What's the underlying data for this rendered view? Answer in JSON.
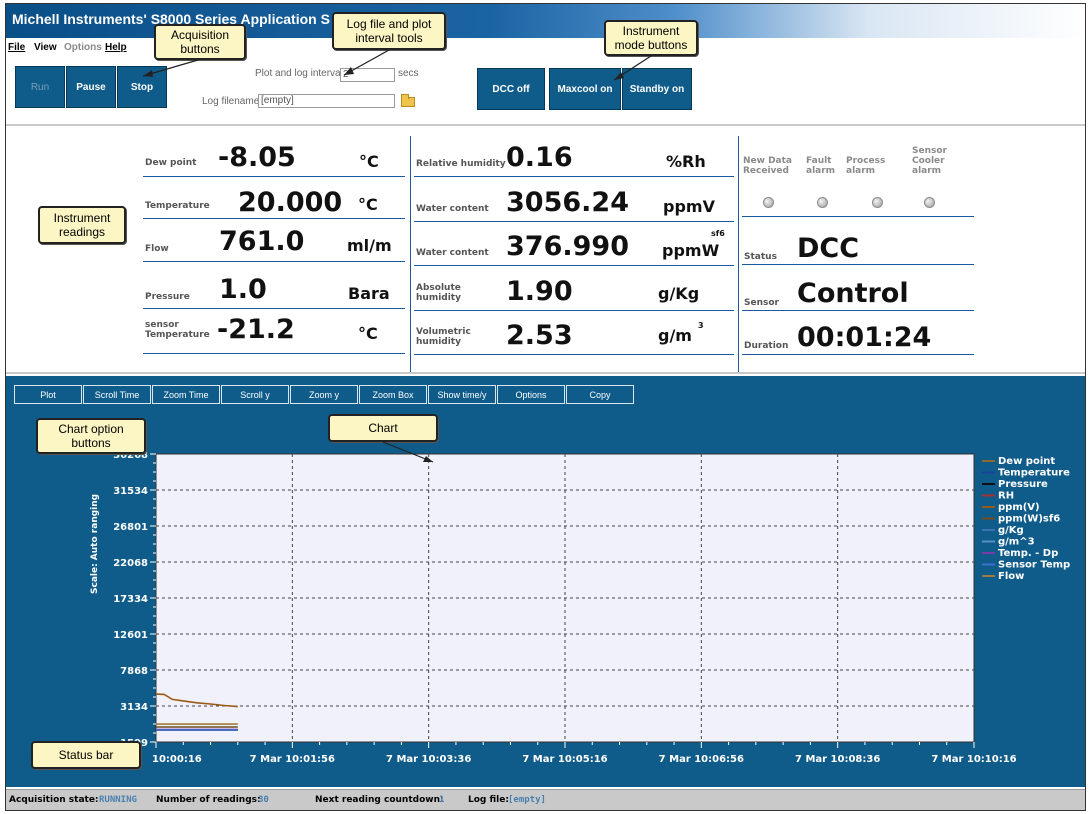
{
  "window": {
    "title": "Michell Instruments' S8000 Series Application S"
  },
  "menu": {
    "file": "File",
    "view": "View",
    "options": "Options",
    "help": "Help"
  },
  "acquisition": {
    "run": "Run",
    "pause": "Pause",
    "stop": "Stop"
  },
  "log_tools": {
    "interval_label": "Plot and log interval",
    "interval_value": "2",
    "interval_unit": "secs",
    "filename_label": "Log filename",
    "filename_value": "[empty]"
  },
  "mode_buttons": {
    "dcc_off": "DCC off",
    "maxcool_on": "Maxcool on",
    "standby_on": "Standby on"
  },
  "readings_left": [
    {
      "label": "Dew point",
      "value": "-8.05",
      "unit": "°C"
    },
    {
      "label": "Temperature",
      "value": "20.000",
      "unit": "°C"
    },
    {
      "label": "Flow",
      "value": "761.0",
      "unit": "ml/m"
    },
    {
      "label": "Pressure",
      "value": "1.0",
      "unit": "Bara"
    },
    {
      "label": "sensor Temperature",
      "value": "-21.2",
      "unit": "°C"
    }
  ],
  "readings_mid": [
    {
      "label": "Relative humidity",
      "value": "0.16",
      "unit": "%Rh",
      "sup": ""
    },
    {
      "label": "Water content",
      "value": "3056.24",
      "unit": "ppmV",
      "sup": ""
    },
    {
      "label": "Water content",
      "value": "376.990",
      "unit": "ppmW",
      "sup": "sf6"
    },
    {
      "label": "Absolute humidity",
      "value": "1.90",
      "unit": "g/Kg",
      "sup": ""
    },
    {
      "label": "Volumetric humidity",
      "value": "2.53",
      "unit": "g/m",
      "sup": "3"
    }
  ],
  "alarms": [
    {
      "label": "New Data Received"
    },
    {
      "label": "Fault alarm"
    },
    {
      "label": "Process alarm"
    },
    {
      "label": "Sensor Cooler alarm"
    }
  ],
  "status_panel": [
    {
      "label": "Status",
      "value": "DCC"
    },
    {
      "label": "Sensor",
      "value": "Control"
    },
    {
      "label": "Duration",
      "value": "00:01:24"
    }
  ],
  "chart_buttons": [
    "Plot",
    "Scroll Time",
    "Zoom Time",
    "Scroll y",
    "Zoom y",
    "Zoom Box",
    "Show time/y",
    "Options",
    "Copy"
  ],
  "chart_data": {
    "type": "line",
    "ylabel": "Scale: Auto ranging",
    "ylim": [
      -1599,
      36268
    ],
    "y_ticks": [
      -1599,
      3134,
      7868,
      12601,
      17334,
      22068,
      26801,
      31534,
      36268
    ],
    "y_tick_labels": [
      "-1599",
      "3134",
      "7868",
      "12601",
      "17334",
      "22068",
      "26801",
      "31534",
      "36268"
    ],
    "x_tick_labels": [
      "10:00:16",
      "7 Mar 10:01:56",
      "7 Mar 10:03:36",
      "7 Mar 10:05:16",
      "7 Mar 10:06:56",
      "7 Mar 10:08:36",
      "7 Mar 10:10:16"
    ],
    "x_range_seconds": [
      0,
      600
    ],
    "grid": true,
    "legend_position": "right",
    "plot_background": "#f1f1fb",
    "series": [
      {
        "name": "Dew point",
        "color": "#8b6a2a",
        "x": [
          0,
          60
        ],
        "y": [
          -8,
          -8
        ]
      },
      {
        "name": "Temperature",
        "color": "#1e3f9e",
        "x": [
          0,
          60
        ],
        "y": [
          20,
          20
        ]
      },
      {
        "name": "Pressure",
        "color": "#111111",
        "x": [
          0,
          60
        ],
        "y": [
          1,
          1
        ]
      },
      {
        "name": "RH",
        "color": "#aa2f2f",
        "x": [
          0,
          60
        ],
        "y": [
          0.2,
          0.2
        ]
      },
      {
        "name": "ppm(V)",
        "color": "#9b5a14",
        "x": [
          0,
          6,
          12,
          20,
          30,
          40,
          50,
          60
        ],
        "y": [
          4700,
          4660,
          4000,
          3800,
          3560,
          3400,
          3200,
          3060
        ]
      },
      {
        "name": "ppm(W)sf6",
        "color": "#6e4c20",
        "x": [
          0,
          60
        ],
        "y": [
          377,
          377
        ]
      },
      {
        "name": "g/Kg",
        "color": "#3a74b5",
        "x": [
          0,
          60
        ],
        "y": [
          1.9,
          1.9
        ]
      },
      {
        "name": "g/m^3",
        "color": "#5a8fc8",
        "x": [
          0,
          60
        ],
        "y": [
          2.5,
          2.5
        ]
      },
      {
        "name": "Temp. - Dp",
        "color": "#7a3aa8",
        "x": [
          0,
          60
        ],
        "y": [
          28,
          28
        ]
      },
      {
        "name": "Sensor Temp",
        "color": "#3b6fd0",
        "x": [
          0,
          60
        ],
        "y": [
          -21,
          -21
        ]
      },
      {
        "name": "Flow",
        "color": "#a07a3a",
        "x": [
          0,
          60
        ],
        "y": [
          761,
          761
        ]
      }
    ]
  },
  "statusbar": {
    "state_label": "Acquisition state:",
    "state_value": "RUNNING",
    "readings_label": "Number of readings:",
    "readings_value": "30",
    "countdown_label": "Next reading countdown:",
    "countdown_value": "1",
    "logfile_label": "Log file:",
    "logfile_value": "[empty]"
  },
  "callouts": {
    "acquisition": "Acquisition buttons",
    "logtools": "Log file and plot interval tools",
    "mode": "Instrument mode buttons",
    "readings": "Instrument readings",
    "chartopts": "Chart option buttons",
    "chart": "Chart",
    "statusbar": "Status bar"
  }
}
